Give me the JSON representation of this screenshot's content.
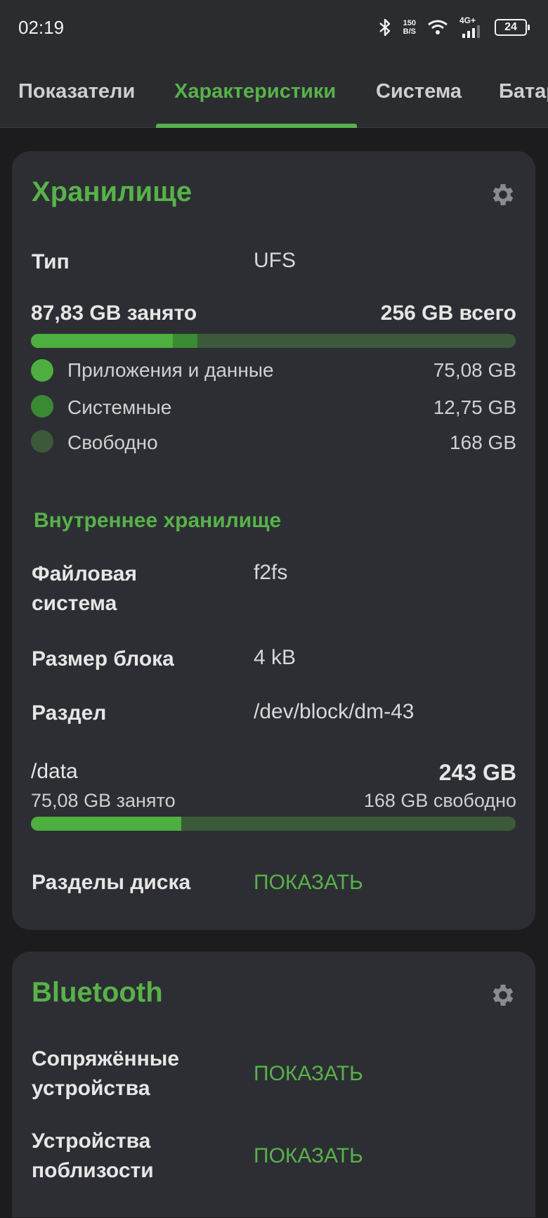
{
  "status_bar": {
    "time": "02:19",
    "net_speed_value": "150",
    "net_speed_unit": "B/S",
    "network_type": "4G+",
    "battery": "24"
  },
  "tabs": [
    {
      "label": "Показатели",
      "active": false
    },
    {
      "label": "Характеристики",
      "active": true
    },
    {
      "label": "Система",
      "active": false
    },
    {
      "label": "Батарея",
      "active": false
    }
  ],
  "storage_card": {
    "title": "Хранилище",
    "type_label": "Тип",
    "type_value": "UFS",
    "used_text": "87,83 GB занято",
    "total_text": "256 GB всего",
    "usage_fractions": {
      "apps": 0.293,
      "system": 0.05,
      "free": 0.657
    },
    "legend": [
      {
        "label": "Приложения и данные",
        "value": "75,08 GB",
        "color": "#4caf3f"
      },
      {
        "label": "Системные",
        "value": "12,75 GB",
        "color": "#3a8a34"
      },
      {
        "label": "Свободно",
        "value": "168 GB",
        "color": "#3b5a3a"
      }
    ],
    "internal_heading": "Внутреннее хранилище",
    "fs_label": "Файловая система",
    "fs_value": "f2fs",
    "block_label": "Размер блока",
    "block_value": "4 kB",
    "partition_label": "Раздел",
    "partition_value": "/dev/block/dm-43",
    "mount_path": "/data",
    "mount_size": "243 GB",
    "mount_used": "75,08 GB занято",
    "mount_free": "168 GB свободно",
    "mount_used_fraction": 0.31,
    "disk_partitions_label": "Разделы диска",
    "disk_partitions_action": "ПОКАЗАТЬ"
  },
  "bluetooth_card": {
    "title": "Bluetooth",
    "paired_label": "Сопряжённые устройства",
    "paired_action": "ПОКАЗАТЬ",
    "nearby_label": "Устройства поблизости",
    "nearby_action": "ПОКАЗАТЬ"
  },
  "colors": {
    "accent": "#57b24a",
    "card_bg": "#2d2e33",
    "page_bg": "#1c1c1e"
  }
}
